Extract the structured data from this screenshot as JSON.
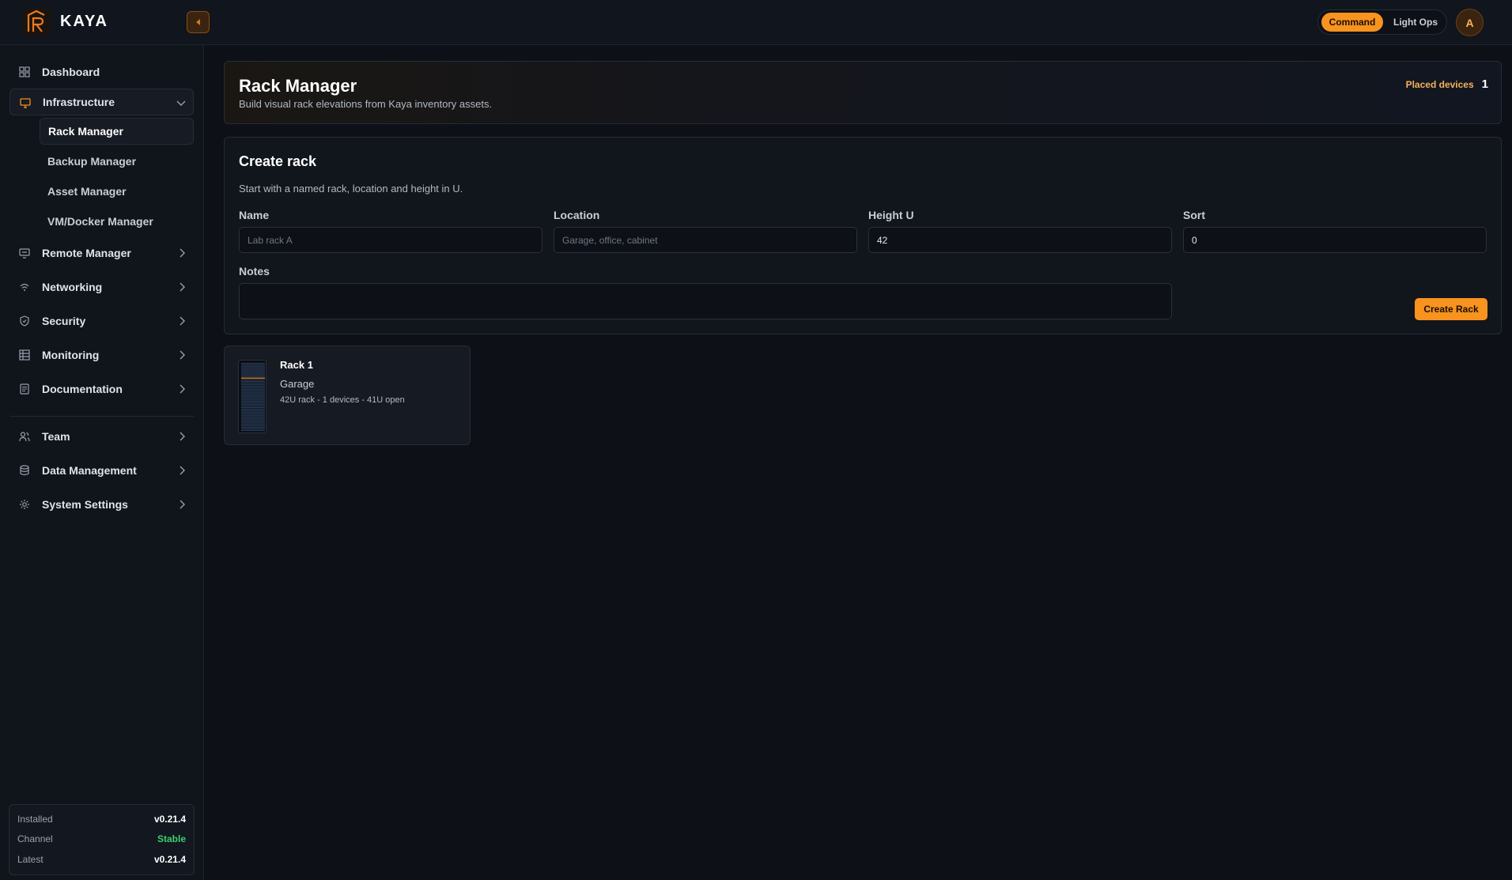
{
  "app": {
    "brand": "KAYA"
  },
  "topbar": {
    "modes": [
      "Command",
      "Light Ops"
    ],
    "active_mode": "Command",
    "avatar_initial": "A"
  },
  "sidebar": {
    "items": [
      {
        "label": "Dashboard",
        "icon": "grid-icon"
      },
      {
        "label": "Infrastructure",
        "icon": "monitor-icon",
        "expanded": true
      },
      {
        "label": "Remote Manager",
        "icon": "remote-desktop-icon"
      },
      {
        "label": "Networking",
        "icon": "wifi-icon"
      },
      {
        "label": "Security",
        "icon": "shield-icon"
      },
      {
        "label": "Monitoring",
        "icon": "table-icon"
      },
      {
        "label": "Documentation",
        "icon": "document-icon"
      },
      {
        "label": "Team",
        "icon": "users-icon"
      },
      {
        "label": "Data Management",
        "icon": "database-icon"
      },
      {
        "label": "System Settings",
        "icon": "gear-icon"
      }
    ],
    "sub_items": [
      "Rack Manager",
      "Backup Manager",
      "Asset Manager",
      "VM/Docker Manager"
    ],
    "active_sub": "Rack Manager",
    "version": {
      "installed_label": "Installed",
      "installed": "v0.21.4",
      "channel_label": "Channel",
      "channel": "Stable",
      "latest_label": "Latest",
      "latest": "v0.21.4"
    }
  },
  "header": {
    "title": "Rack Manager",
    "subtitle": "Build visual rack elevations from Kaya inventory assets.",
    "placed_label": "Placed devices",
    "placed_value": "1"
  },
  "create": {
    "title": "Create rack",
    "subtitle": "Start with a named rack, location and height in U.",
    "name_label": "Name",
    "name_placeholder": "Lab rack A",
    "name_value": "",
    "location_label": "Location",
    "location_placeholder": "Garage, office, cabinet",
    "location_value": "",
    "height_label": "Height U",
    "height_value": "42",
    "sort_label": "Sort",
    "sort_value": "0",
    "notes_label": "Notes",
    "button": "Create Rack"
  },
  "racks": [
    {
      "name": "Rack 1",
      "location": "Garage",
      "meta": "42U rack - 1 devices - 41U open"
    }
  ],
  "colors": {
    "accent": "#f7931e",
    "background": "#0d1017",
    "success": "#3ccf6b"
  }
}
